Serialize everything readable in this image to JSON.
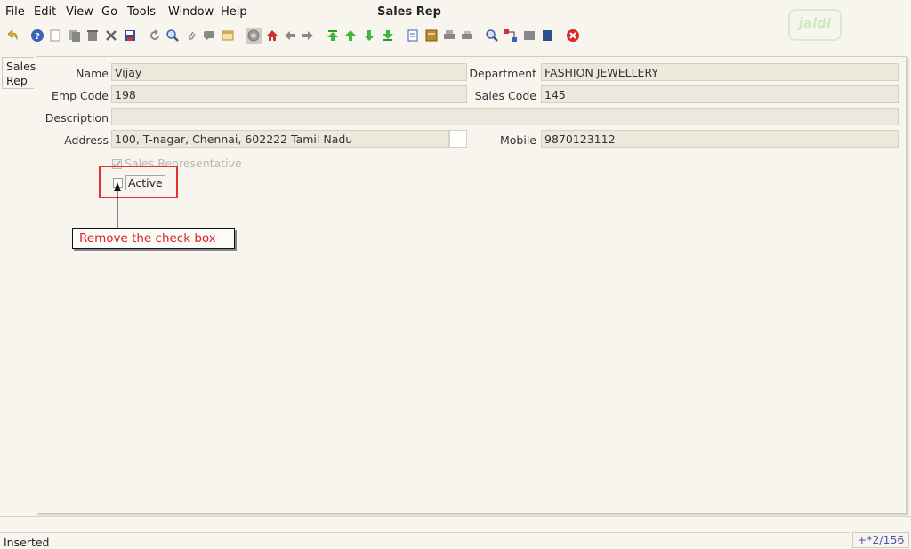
{
  "menu": {
    "file": "File",
    "edit": "Edit",
    "view": "View",
    "go": "Go",
    "tools": "Tools",
    "window": "Window",
    "help": "Help"
  },
  "window_title": "Sales Rep",
  "logo_text": "jaldi",
  "tab": {
    "line1": "Sales",
    "line2": "Rep"
  },
  "form": {
    "name_label": "Name",
    "name_value": "Vijay",
    "department_label": "Department",
    "department_value": "FASHION JEWELLERY",
    "emp_code_label": "Emp Code",
    "emp_code_value": "198",
    "sales_code_label": "Sales Code",
    "sales_code_value": "145",
    "description_label": "Description",
    "description_value": "",
    "address_label": "Address",
    "address_value": "100, T-nagar, Chennai,  602222 Tamil Nadu",
    "mobile_label": "Mobile",
    "mobile_value": "9870123112",
    "sales_rep_label": "Sales Representative",
    "active_label": "Active"
  },
  "annotation": {
    "callout_text": "Remove the check box",
    "color": "#e43232"
  },
  "status": {
    "text": "Inserted",
    "record": "+*2/156"
  }
}
